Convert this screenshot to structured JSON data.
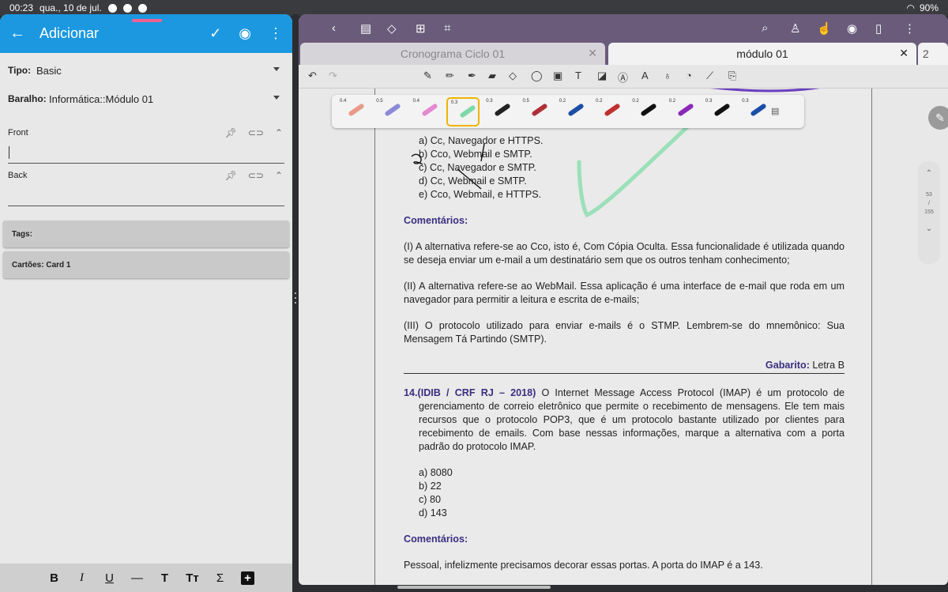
{
  "status_bar": {
    "time": "00:23",
    "date": "qua., 10 de jul.",
    "battery": "90%"
  },
  "left_app": {
    "title": "Adicionar",
    "tipo": {
      "label": "Tipo:",
      "value": "Basic"
    },
    "baralho": {
      "label": "Baralho:",
      "value": "Informática::Módulo 01"
    },
    "front_label": "Front",
    "back_label": "Back",
    "tags_label": "Tags:",
    "cards_label": "Cartões: Card 1",
    "format_buttons": [
      "B",
      "I",
      "U",
      "—",
      "T",
      "Tт",
      "Σ",
      "+"
    ]
  },
  "right_app": {
    "tabs": [
      {
        "label": "Cronograma Ciclo 01"
      },
      {
        "label": "módulo 01"
      }
    ],
    "tab_count": "2",
    "pens": [
      {
        "size": "0.4",
        "color": "#e89a88"
      },
      {
        "size": "0.5",
        "color": "#8c8ad8"
      },
      {
        "size": "0.4",
        "color": "#e38ad0"
      },
      {
        "size": "0.3",
        "color": "#7ed8a8"
      },
      {
        "size": "0.3",
        "color": "#222222"
      },
      {
        "size": "0.5",
        "color": "#b0303a"
      },
      {
        "size": "0.2",
        "color": "#1c4ea8"
      },
      {
        "size": "0.2",
        "color": "#c0302e"
      },
      {
        "size": "0.2",
        "color": "#111111"
      },
      {
        "size": "0.2",
        "color": "#8a28b8"
      },
      {
        "size": "0.3",
        "color": "#111111"
      },
      {
        "size": "0.3",
        "color": "#1c4ea8"
      }
    ],
    "page_nav": {
      "current": "53",
      "sep": "/",
      "total": "155"
    },
    "document": {
      "options_q13": [
        "a) Cc, Navegador e HTTPS.",
        "b) Cco, Webmail e SMTP.",
        "c) Cc, Navegador e SMTP.",
        "d) Cc, Webmail e SMTP.",
        "e) Cco, Webmail, e HTTPS."
      ],
      "comentarios_label": "Comentários:",
      "comment_1": "(I) A alternativa refere-se ao Cco, isto é, Com Cópia Oculta. Essa funcionalidade é utilizada quando se deseja enviar um e-mail a um destinatário sem que os outros tenham conhecimento;",
      "comment_2": "(II) A alternativa refere-se ao WebMail. Essa aplicação é uma interface de e-mail que roda em um navegador para permitir a leitura e escrita de e-mails;",
      "comment_3": "(III) O protocolo utilizado para enviar e-mails é o STMP. Lembrem-se do mnemônico: Sua Mensagem Tá Partindo (SMTP).",
      "gabarito_label": "Gabarito:",
      "gabarito_value": "Letra B",
      "q14_number": "14.",
      "q14_source": "(IDIB / CRF RJ – 2018)",
      "q14_text": "O Internet Message Access Protocol (IMAP) é um protocolo de gerenciamento de correio eletrônico que permite o recebimento de mensagens. Ele tem mais recursos que o protocolo POP3, que é um protocolo bastante utilizado por clientes para recebimento de emails. Com base nessas informações, marque a alternativa com a porta padrão do protocolo IMAP.",
      "options_q14": [
        "a) 8080",
        "b) 22",
        "c) 80",
        "d) 143"
      ],
      "comentarios_label_2": "Comentários:",
      "last_line": "Pessoal, infelizmente precisamos decorar essas portas. A porta do IMAP é a 143."
    }
  }
}
